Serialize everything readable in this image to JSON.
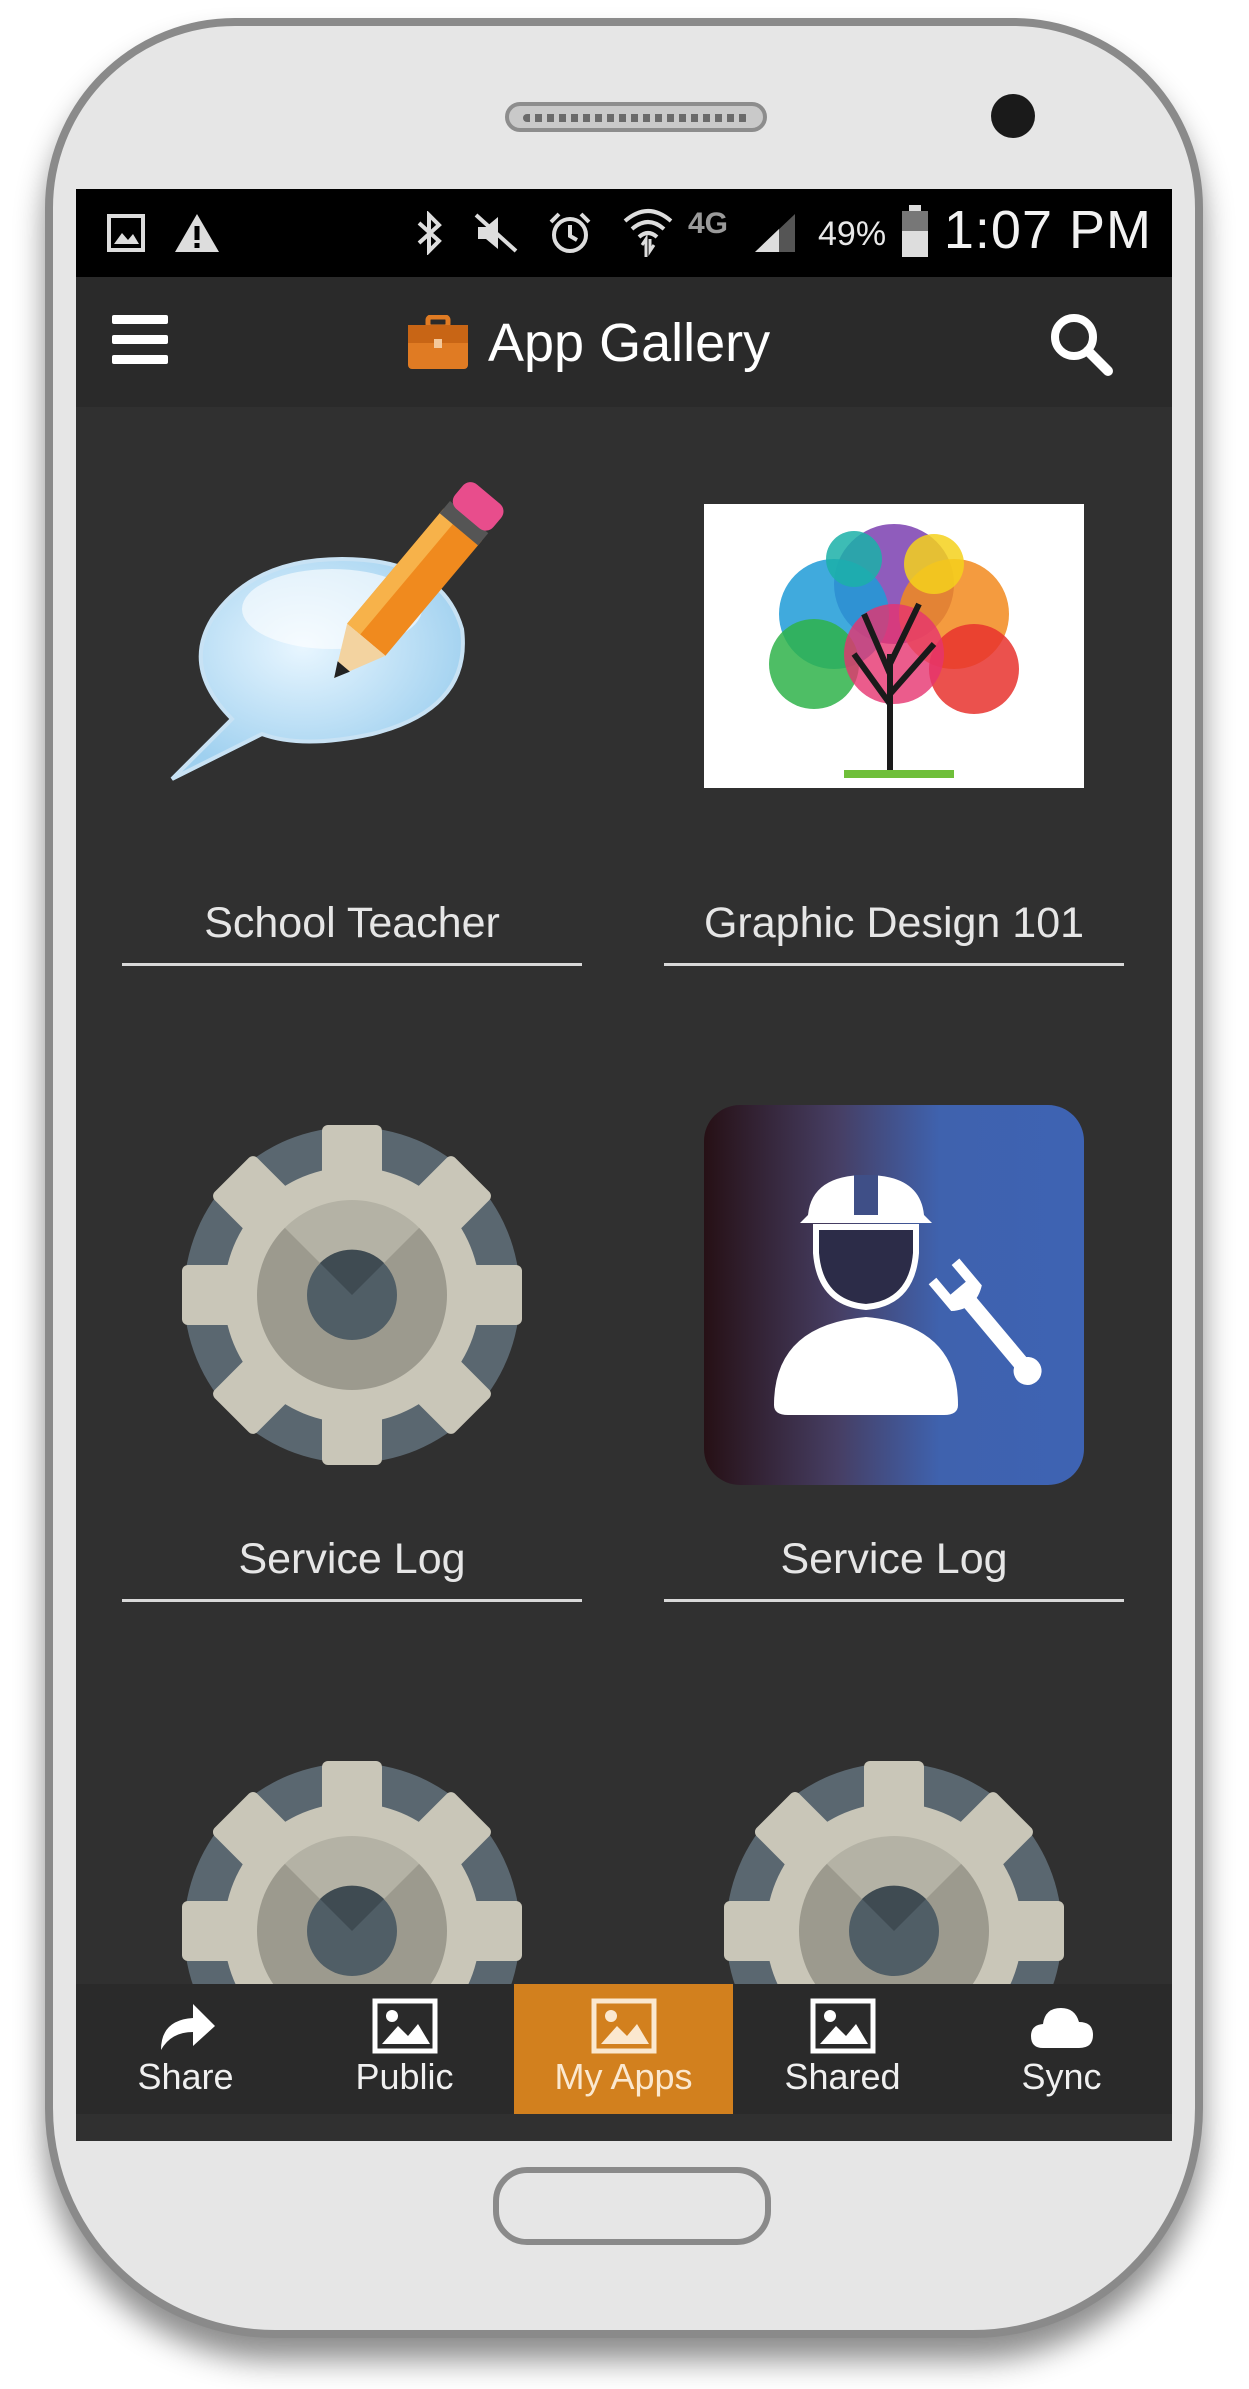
{
  "status_bar": {
    "battery": "49%",
    "network": "4G",
    "time": "1:07 PM",
    "icons": [
      "image-icon",
      "warning-icon",
      "bluetooth-icon",
      "mute-icon",
      "alarm-icon",
      "wifi-icon",
      "signal-icon",
      "battery-icon"
    ]
  },
  "app_bar": {
    "title": "App Gallery",
    "icons": [
      "menu-icon",
      "briefcase-icon",
      "search-icon"
    ],
    "accent": "#e07b23"
  },
  "apps": [
    {
      "label": "School Teacher",
      "icon": "speech-pencil-icon"
    },
    {
      "label": "Graphic Design 101",
      "icon": "color-tree-image"
    },
    {
      "label": "Service Log",
      "icon": "gear-icon"
    },
    {
      "label": "Service Log",
      "icon": "worker-wrench-icon"
    },
    {
      "label": "",
      "icon": "gear-icon"
    },
    {
      "label": "",
      "icon": "gear-icon"
    }
  ],
  "bottom_nav": {
    "items": [
      {
        "label": "Share",
        "icon": "share-icon",
        "active": false
      },
      {
        "label": "Public",
        "icon": "image-icon",
        "active": false
      },
      {
        "label": "My Apps",
        "icon": "image-icon",
        "active": true
      },
      {
        "label": "Shared",
        "icon": "image-icon",
        "active": false
      },
      {
        "label": "Sync",
        "icon": "cloud-icon",
        "active": false
      }
    ],
    "active_color": "#d2801e"
  }
}
